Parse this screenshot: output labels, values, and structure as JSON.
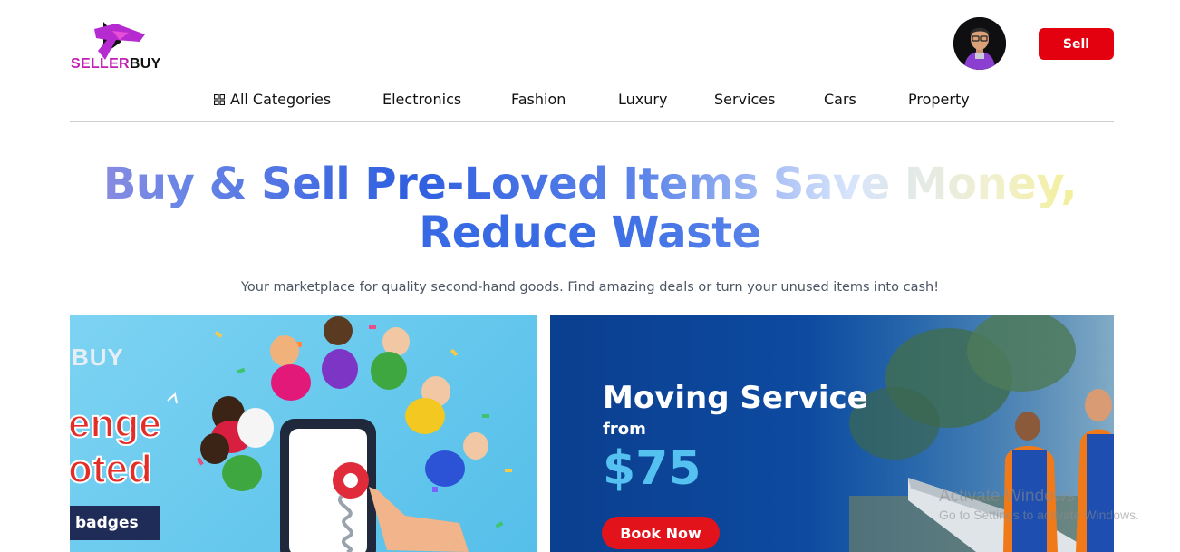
{
  "header": {
    "logo": {
      "part1": "SELLER",
      "part2": "BUY"
    },
    "sell_label": "Sell"
  },
  "nav": {
    "items": [
      {
        "label": "All Categories",
        "icon": "grid-icon"
      },
      {
        "label": "Electronics"
      },
      {
        "label": "Fashion"
      },
      {
        "label": "Luxury"
      },
      {
        "label": "Services"
      },
      {
        "label": "Cars"
      },
      {
        "label": "Property"
      }
    ]
  },
  "hero": {
    "title_line1": "Buy & Sell Pre-Loved Items Save Money,",
    "title_line2": "Reduce Waste",
    "subtitle": "Your marketplace for quality second-hand goods. Find amazing deals or turn your unused items into cash!"
  },
  "banners": {
    "left": {
      "brand": "BUY",
      "word1": "enge",
      "word2": "oted",
      "badge": "badges"
    },
    "right": {
      "title": "Moving Service",
      "from": "from",
      "price": "$75",
      "cta": "Book Now"
    }
  },
  "watermark": {
    "line1": "Activate Windows",
    "line2": "Go to Settings to activate Windows."
  },
  "colors": {
    "accent": "#e3000f",
    "nav_text": "#111111",
    "right_banner_bg": "#0d4aa0",
    "left_banner_bg": "#66c6ee",
    "price": "#54c1f0"
  }
}
